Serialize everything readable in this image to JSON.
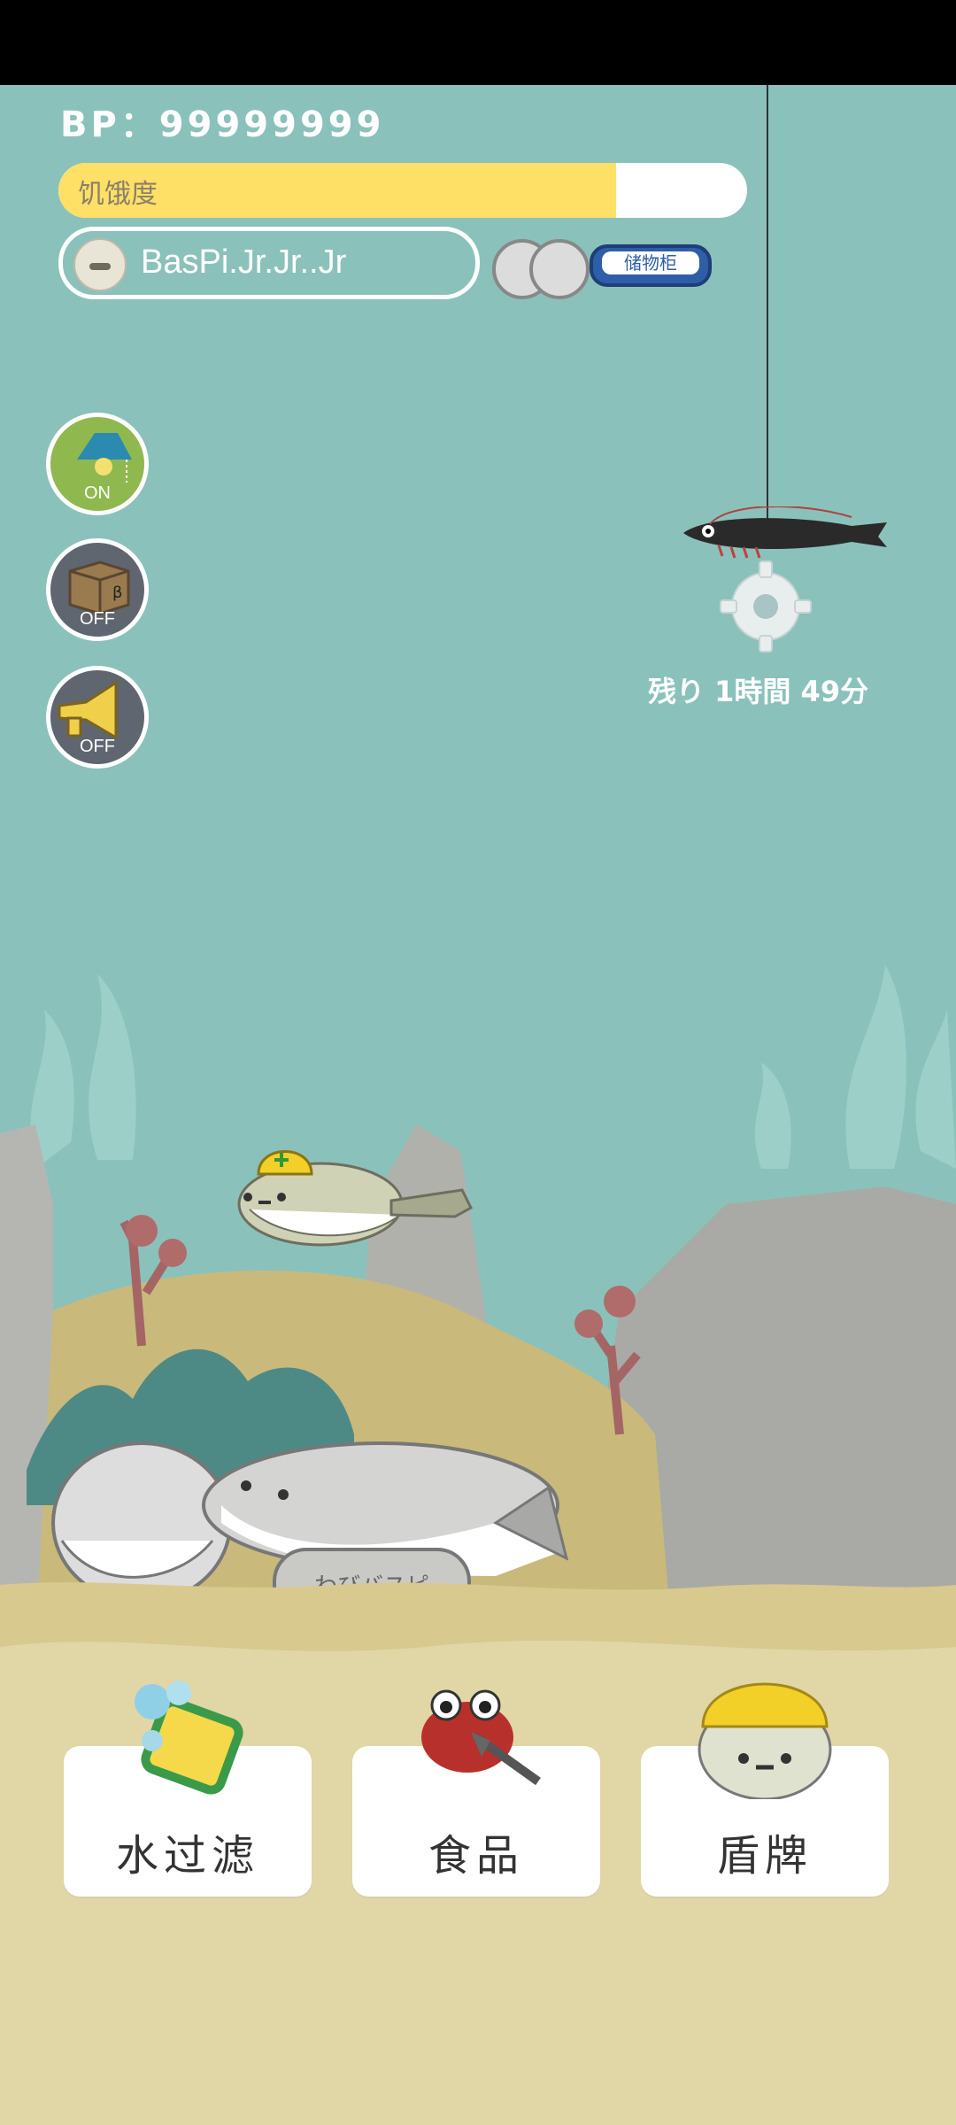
{
  "header": {
    "bp_text": "BP：99999999",
    "hunger_label": "饥饿度",
    "hunger_level_percent": 81,
    "pet_name": "BasPi.Jr.Jr..Jr",
    "locker_label": "储物柜"
  },
  "side_buttons": [
    {
      "id": "lamp",
      "state": "ON",
      "color": "#8fb84f"
    },
    {
      "id": "box",
      "state": "OFF",
      "color": "#5f6670"
    },
    {
      "id": "megaphone",
      "state": "OFF",
      "color": "#5f6670"
    }
  ],
  "timer": "残り 1時間 49分",
  "cards": [
    {
      "id": "water-filter",
      "label": "水过滤"
    },
    {
      "id": "food",
      "label": "食品"
    },
    {
      "id": "shield",
      "label": "盾牌"
    }
  ],
  "rock_text": "わびバスピ",
  "colors": {
    "water": "#8bc1bb",
    "sand": "#e1d6a5",
    "hunger": "#ffe066"
  }
}
